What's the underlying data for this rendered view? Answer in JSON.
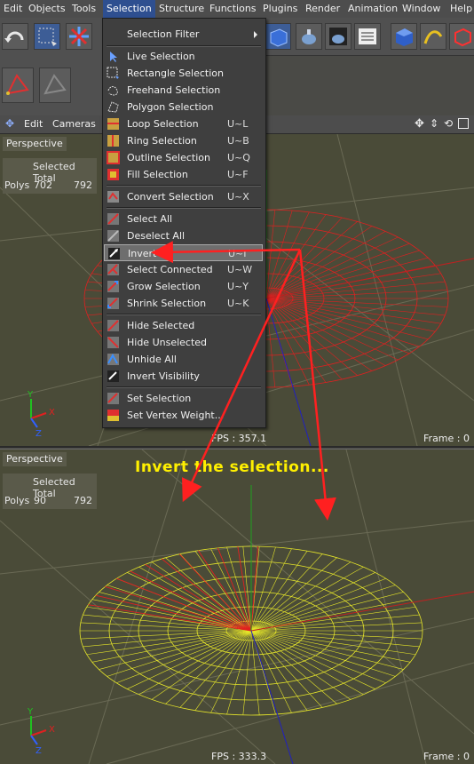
{
  "menubar": {
    "items": [
      {
        "label": "Edit"
      },
      {
        "label": "Objects"
      },
      {
        "label": "Tools"
      },
      {
        "label": "Selection"
      },
      {
        "label": "Structure"
      },
      {
        "label": "Functions"
      },
      {
        "label": "Plugins"
      },
      {
        "label": "Render"
      },
      {
        "label": "Animation"
      },
      {
        "label": "Window"
      },
      {
        "label": "Help"
      }
    ],
    "active": "Selection"
  },
  "viewbar": {
    "edit": "Edit",
    "cameras": "Cameras"
  },
  "dropdown": {
    "items": [
      {
        "label": "Selection Filter",
        "shortcut": "",
        "icon": "none",
        "submenu": true
      },
      {
        "label": "Live Selection",
        "shortcut": "",
        "icon": "live-selection-icon"
      },
      {
        "label": "Rectangle Selection",
        "shortcut": "",
        "icon": "rectangle-selection-icon"
      },
      {
        "label": "Freehand Selection",
        "shortcut": "",
        "icon": "freehand-selection-icon"
      },
      {
        "label": "Polygon Selection",
        "shortcut": "",
        "icon": "polygon-selection-icon"
      },
      {
        "label": "Loop Selection",
        "shortcut": "U~L",
        "icon": "loop-selection-icon"
      },
      {
        "label": "Ring Selection",
        "shortcut": "U~B",
        "icon": "ring-selection-icon"
      },
      {
        "label": "Outline Selection",
        "shortcut": "U~Q",
        "icon": "outline-selection-icon"
      },
      {
        "label": "Fill Selection",
        "shortcut": "U~F",
        "icon": "fill-selection-icon"
      },
      {
        "label": "Convert Selection",
        "shortcut": "U~X",
        "icon": "convert-selection-icon"
      },
      {
        "label": "Select All",
        "shortcut": "",
        "icon": "select-all-icon"
      },
      {
        "label": "Deselect All",
        "shortcut": "",
        "icon": "deselect-all-icon"
      },
      {
        "label": "Invert",
        "shortcut": "U~I",
        "icon": "invert-icon",
        "highlighted": true
      },
      {
        "label": "Select Connected",
        "shortcut": "U~W",
        "icon": "select-connected-icon"
      },
      {
        "label": "Grow Selection",
        "shortcut": "U~Y",
        "icon": "grow-selection-icon"
      },
      {
        "label": "Shrink Selection",
        "shortcut": "U~K",
        "icon": "shrink-selection-icon"
      },
      {
        "label": "Hide Selected",
        "shortcut": "",
        "icon": "hide-selected-icon"
      },
      {
        "label": "Hide Unselected",
        "shortcut": "",
        "icon": "hide-unselected-icon"
      },
      {
        "label": "Unhide All",
        "shortcut": "",
        "icon": "unhide-all-icon"
      },
      {
        "label": "Invert Visibility",
        "shortcut": "",
        "icon": "invert-visibility-icon"
      },
      {
        "label": "Set Selection",
        "shortcut": "",
        "icon": "set-selection-icon"
      },
      {
        "label": "Set Vertex Weight...",
        "shortcut": "",
        "icon": "set-vertex-weight-icon"
      }
    ]
  },
  "viewport_top": {
    "title": "Perspective",
    "stats_header": "Selected Total",
    "row_label": "Polys",
    "selected": "702",
    "total": "792",
    "fps": "FPS : 357.1",
    "frame": "Frame : 0"
  },
  "viewport_bottom": {
    "title": "Perspective",
    "stats_header": "Selected Total",
    "row_label": "Polys",
    "selected": "90",
    "total": "792",
    "fps": "FPS : 333.3",
    "frame": "Frame : 0"
  },
  "annotation": "Invert the selection...",
  "colors": {
    "menu_active": "#2e4f90",
    "viewport_bg": "#4a4b38",
    "selected_wire": "#e02020",
    "unselected_wire": "#e6e62a",
    "annotation": "#fff000",
    "arrow": "#ff2020"
  }
}
